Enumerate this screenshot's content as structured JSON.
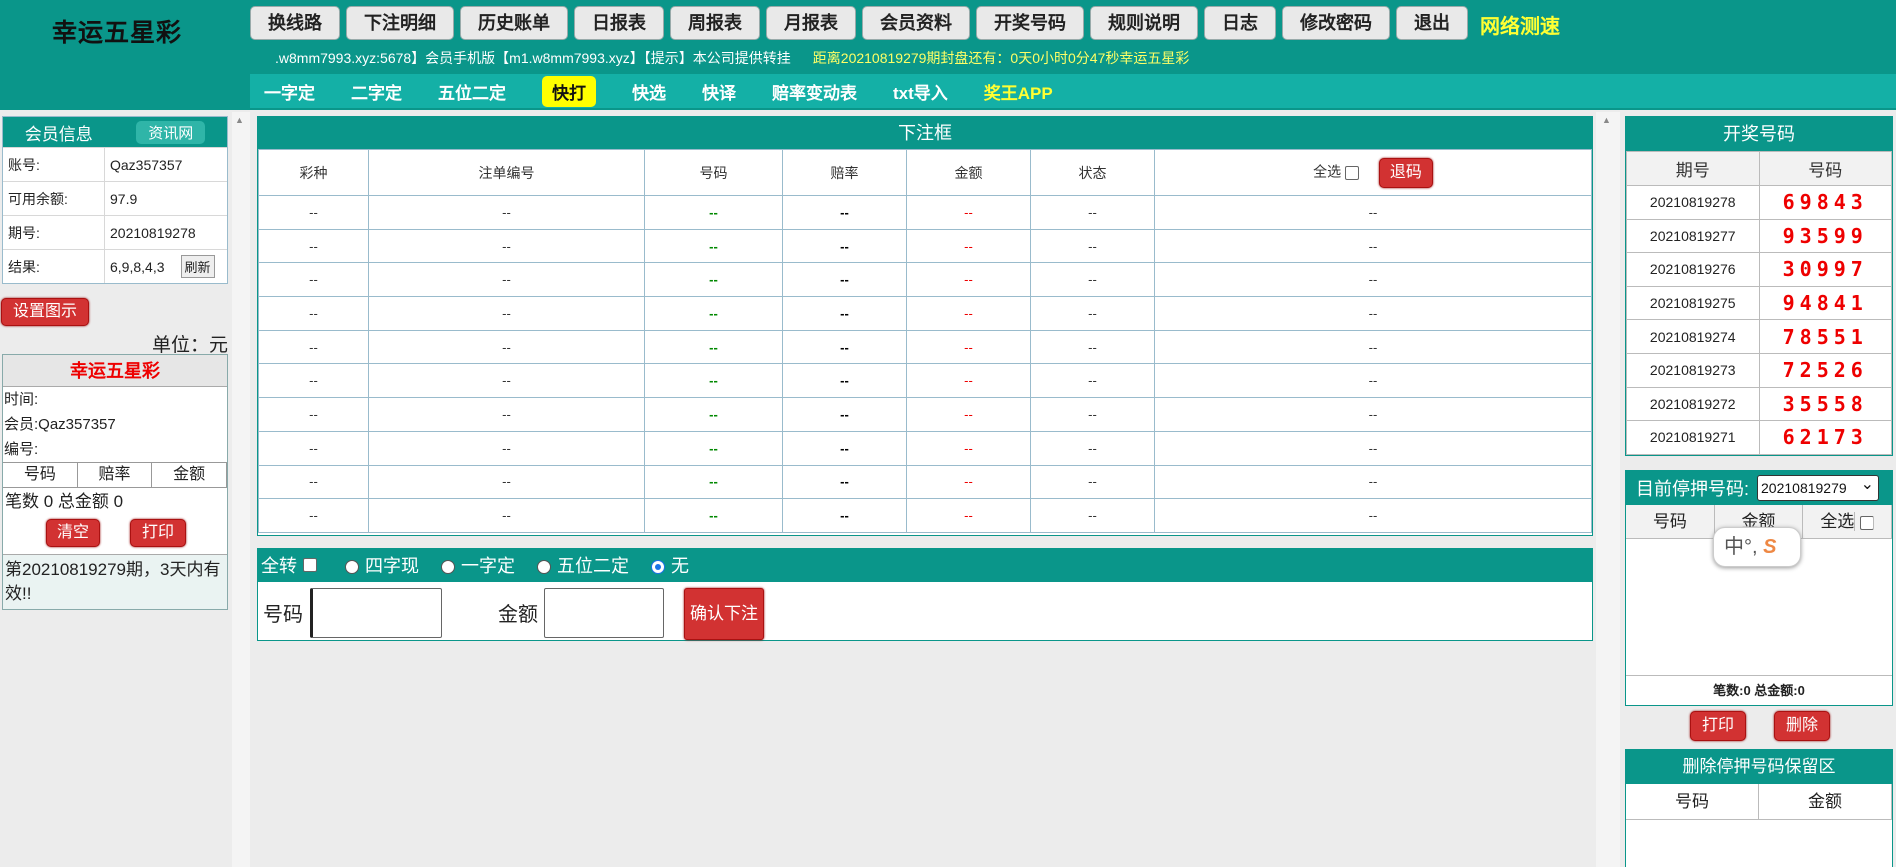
{
  "app": {
    "title": "幸运五星彩",
    "net_test": "网络测速"
  },
  "nav": [
    "换线路",
    "下注明细",
    "历史账单",
    "日报表",
    "周报表",
    "月报表",
    "会员资料",
    "开奖号码",
    "规则说明",
    "日志",
    "修改密码",
    "退出"
  ],
  "ticker": {
    "left": ".w8mm7993.xyz:5678】会员手机版【m1.w8mm7993.xyz】【提示】本公司提供转挂",
    "right": "距离20210819279期封盘还有：0天0小时0分47秒幸运五星彩"
  },
  "subnav": [
    "一字定",
    "二字定",
    "五位二定",
    "快打",
    "快选",
    "快译",
    "赔率变动表",
    "txt导入",
    "奖王APP"
  ],
  "subnav_active": "快打",
  "member": {
    "title": "会员信息",
    "info_btn": "资讯网",
    "rows": [
      {
        "k": "账号:",
        "v": "Qaz357357"
      },
      {
        "k": "可用余额:",
        "v": "97.9"
      },
      {
        "k": "期号:",
        "v": "20210819278"
      },
      {
        "k": "结果:",
        "v": "6,9,8,4,3"
      }
    ],
    "refresh": "刷新"
  },
  "settings_btn": "设置图示",
  "unit": "单位：元",
  "print": {
    "title": "幸运五星彩",
    "time": "时间:",
    "member": "会员:Qaz357357",
    "serial": "编号:",
    "cols": [
      "号码",
      "赔率",
      "金额"
    ],
    "summary": "笔数 0 总金额 0",
    "clear": "清空",
    "print": "打印",
    "note": "第20210819279期，3天内有效!!"
  },
  "bet": {
    "title": "下注框",
    "cols": [
      "彩种",
      "注单编号",
      "号码",
      "赔率",
      "金额",
      "状态"
    ],
    "select_all": "全选",
    "refund": "退码",
    "rows": [
      [
        "--",
        "--",
        "--",
        "--",
        "--",
        "--",
        "--"
      ],
      [
        "--",
        "--",
        "--",
        "--",
        "--",
        "--",
        "--"
      ],
      [
        "--",
        "--",
        "--",
        "--",
        "--",
        "--",
        "--"
      ],
      [
        "--",
        "--",
        "--",
        "--",
        "--",
        "--",
        "--"
      ],
      [
        "--",
        "--",
        "--",
        "--",
        "--",
        "--",
        "--"
      ],
      [
        "--",
        "--",
        "--",
        "--",
        "--",
        "--",
        "--"
      ],
      [
        "--",
        "--",
        "--",
        "--",
        "--",
        "--",
        "--"
      ],
      [
        "--",
        "--",
        "--",
        "--",
        "--",
        "--",
        "--"
      ],
      [
        "--",
        "--",
        "--",
        "--",
        "--",
        "--",
        "--"
      ],
      [
        "--",
        "--",
        "--",
        "--",
        "--",
        "--",
        "--"
      ]
    ]
  },
  "options": {
    "full_turn": "全转",
    "radios": [
      "四字现",
      "一字定",
      "五位二定",
      "无"
    ],
    "selected": "无"
  },
  "input": {
    "number_label": "号码",
    "amount_label": "金额",
    "confirm": "确认下注"
  },
  "draws": {
    "title": "开奖号码",
    "cols": [
      "期号",
      "号码"
    ],
    "rows": [
      {
        "period": "20210819278",
        "nums": "69843"
      },
      {
        "period": "20210819277",
        "nums": "93599"
      },
      {
        "period": "20210819276",
        "nums": "30997"
      },
      {
        "period": "20210819275",
        "nums": "94841"
      },
      {
        "period": "20210819274",
        "nums": "78551"
      },
      {
        "period": "20210819273",
        "nums": "72526"
      },
      {
        "period": "20210819272",
        "nums": "35558"
      },
      {
        "period": "20210819271",
        "nums": "62173"
      }
    ]
  },
  "stop": {
    "label": "目前停押号码:",
    "period": "20210819279",
    "cols": [
      "号码",
      "金额",
      "全选"
    ],
    "summary": "笔数:0  总金额:0",
    "print": "打印",
    "delete": "删除"
  },
  "ime": {
    "text": "中°,",
    "s": "S"
  },
  "reserve": {
    "title": "删除停押号码保留区",
    "cols": [
      "号码",
      "金额"
    ]
  }
}
